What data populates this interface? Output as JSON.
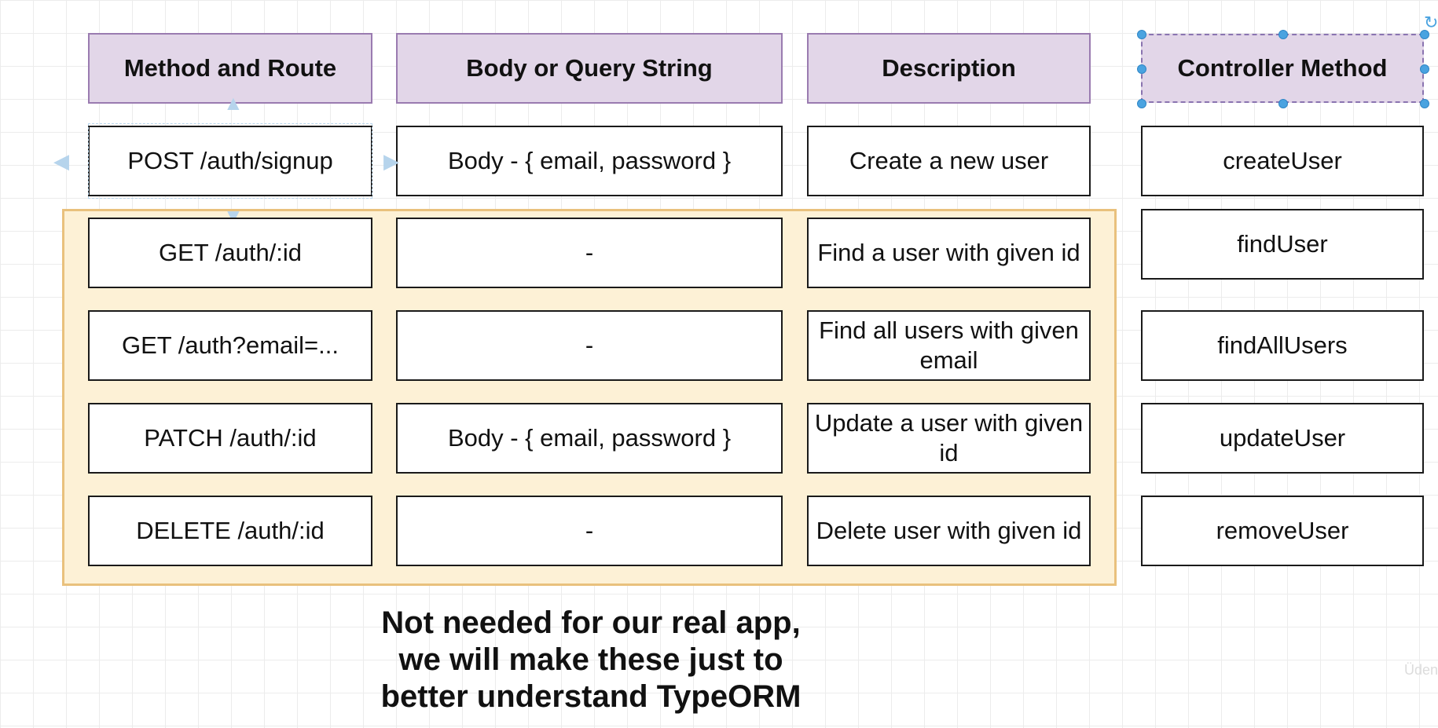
{
  "headers": {
    "method_route": "Method and Route",
    "body_query": "Body or Query String",
    "description": "Description",
    "controller_method": "Controller Method"
  },
  "rows": [
    {
      "route": "POST /auth/signup",
      "body": "Body - { email, password }",
      "description": "Create a new user",
      "controller": "createUser"
    },
    {
      "route": "GET /auth/:id",
      "body": "-",
      "description": "Find a user with given id",
      "controller": "findUser"
    },
    {
      "route": "GET /auth?email=...",
      "body": "-",
      "description": "Find all users with given email",
      "controller": "findAllUsers"
    },
    {
      "route": "PATCH /auth/:id",
      "body": "Body - { email, password }",
      "description": "Update a user with given id",
      "controller": "updateUser"
    },
    {
      "route": "DELETE /auth/:id",
      "body": "-",
      "description": "Delete user with given id",
      "controller": "removeUser"
    }
  ],
  "note": "Not needed for our real app,\nwe will make these just to\nbetter understand TypeORM",
  "watermark": "Üden",
  "colors": {
    "header_fill": "#e2d6e8",
    "header_border": "#9a7bb0",
    "highlight_fill": "#fdf1d6",
    "highlight_border": "#e9c17d",
    "selection_handle": "#4aa3e0"
  }
}
